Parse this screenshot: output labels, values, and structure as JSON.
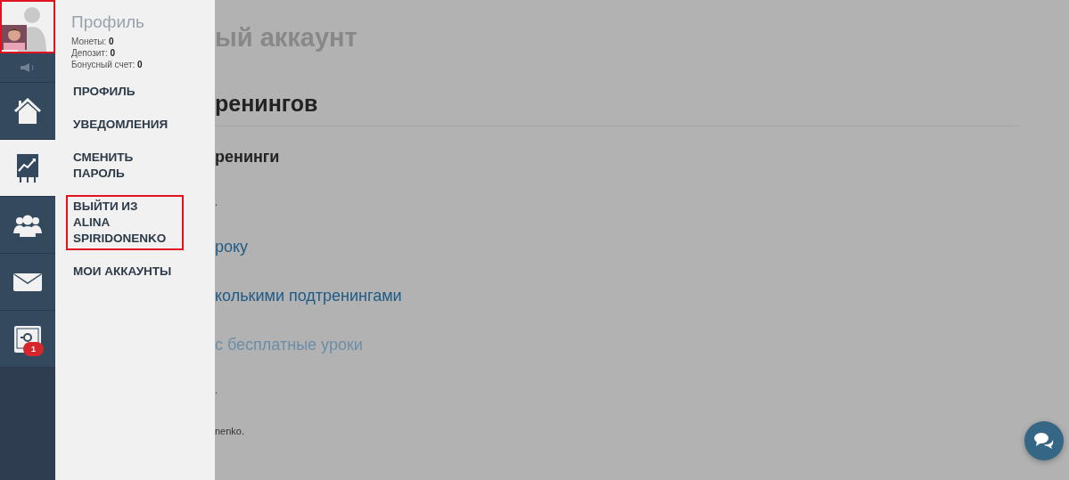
{
  "sidebar": {
    "avatar": {
      "highlighted": true
    },
    "items": [
      {
        "kind": "speaker",
        "selected": false
      },
      {
        "kind": "home",
        "selected": false
      },
      {
        "kind": "chart",
        "selected": true
      },
      {
        "kind": "users",
        "selected": false
      },
      {
        "kind": "mail",
        "selected": false
      },
      {
        "kind": "settings",
        "selected": false,
        "badge": "1"
      }
    ]
  },
  "profile_menu": {
    "title": "Профиль",
    "stats": [
      {
        "label": "Монеты:",
        "value": "0"
      },
      {
        "label": "Депозит:",
        "value": "0"
      },
      {
        "label": "Бонусный счет:",
        "value": "0"
      }
    ],
    "items": [
      {
        "label": "ПРОФИЛЬ",
        "highlighted": false
      },
      {
        "label": "УВЕДОМЛЕНИЯ",
        "highlighted": false
      },
      {
        "label": "СМЕНИТЬ ПАРОЛЬ",
        "highlighted": false
      },
      {
        "label": "ВЫЙТИ ИЗ ALINA SPIRIDONENKO",
        "highlighted": true
      },
      {
        "label": "МОИ АККАУНТЫ",
        "highlighted": false
      }
    ]
  },
  "content": [
    {
      "kind": "title",
      "text": "ый аккаунт"
    },
    {
      "kind": "heading",
      "text": "ренингов"
    },
    {
      "kind": "subheading",
      "text": "ренинги"
    },
    {
      "kind": "note",
      "text": "."
    },
    {
      "kind": "link",
      "text": "року"
    },
    {
      "kind": "link",
      "text": "колькими подтренингами"
    },
    {
      "kind": "muted-link",
      "text": "с бесплатные уроки"
    },
    {
      "kind": "note",
      "text": "."
    },
    {
      "kind": "note",
      "text": "nenko."
    }
  ]
}
